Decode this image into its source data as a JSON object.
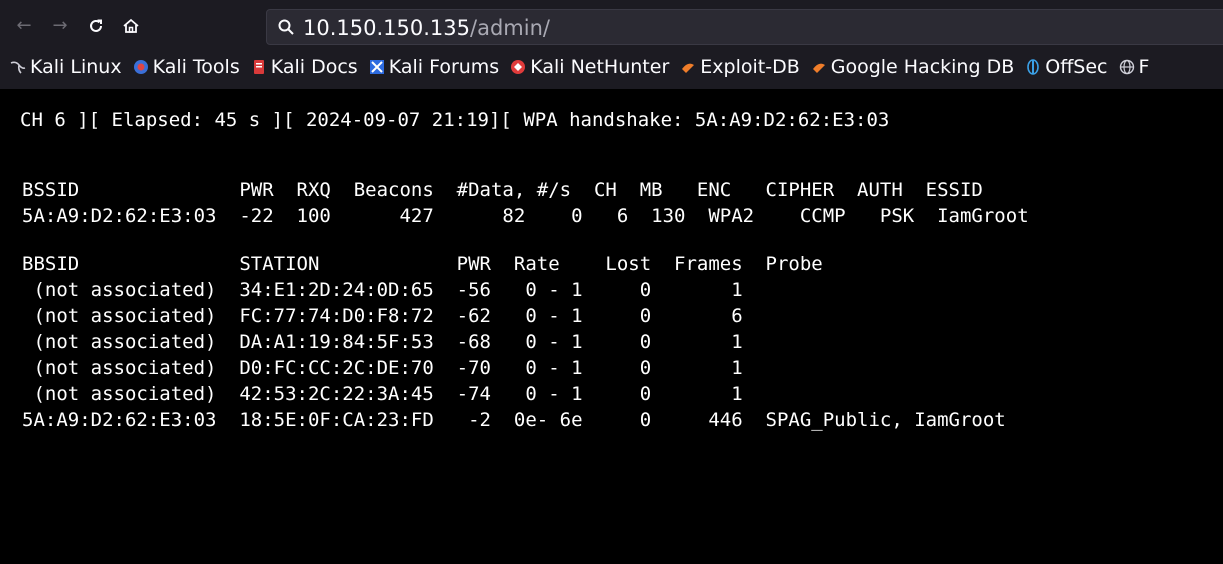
{
  "browser": {
    "url_host": "10.150.150.135",
    "url_path": "/admin/",
    "bookmarks": [
      {
        "label": "Kali Linux",
        "icon": "kali-dragon-icon"
      },
      {
        "label": "Kali Tools",
        "icon": "kali-tools-icon"
      },
      {
        "label": "Kali Docs",
        "icon": "kali-docs-icon"
      },
      {
        "label": "Kali Forums",
        "icon": "kali-forums-icon"
      },
      {
        "label": "Kali NetHunter",
        "icon": "kali-nethunter-icon"
      },
      {
        "label": "Exploit-DB",
        "icon": "exploit-db-icon"
      },
      {
        "label": "Google Hacking DB",
        "icon": "google-hacking-db-icon"
      },
      {
        "label": "OffSec",
        "icon": "offsec-icon"
      },
      {
        "label": "F",
        "icon": "globe-icon"
      }
    ]
  },
  "terminal": {
    "status_line": "CH 6 ][ Elapsed: 45 s ][ 2024-09-07 21:19][ WPA handshake: 5A:A9:D2:62:E3:03",
    "ap_header": "BSSID              PWR  RXQ  Beacons  #Data, #/s  CH  MB   ENC   CIPHER  AUTH  ESSID",
    "ap_rows": [
      "5A:A9:D2:62:E3:03  -22  100      427      82    0   6  130  WPA2    CCMP   PSK  IamGroot"
    ],
    "station_header": "BBSID              STATION            PWR  Rate    Lost  Frames  Probe",
    "station_rows": [
      " (not associated)  34:E1:2D:24:0D:65  -56   0 - 1     0       1",
      " (not associated)  FC:77:74:D0:F8:72  -62   0 - 1     0       6",
      " (not associated)  DA:A1:19:84:5F:53  -68   0 - 1     0       1",
      " (not associated)  D0:FC:CC:2C:DE:70  -70   0 - 1     0       1",
      " (not associated)  42:53:2C:22:3A:45  -74   0 - 1     0       1",
      "5A:A9:D2:62:E3:03  18:5E:0F:CA:23:FD   -2  0e- 6e     0     446  SPAG_Public, IamGroot"
    ]
  },
  "colors": {
    "chrome_bg": "#1c1b22",
    "url_bar_bg": "#2b2a33",
    "terminal_bg": "#000000",
    "terminal_fg": "#ffffff"
  }
}
